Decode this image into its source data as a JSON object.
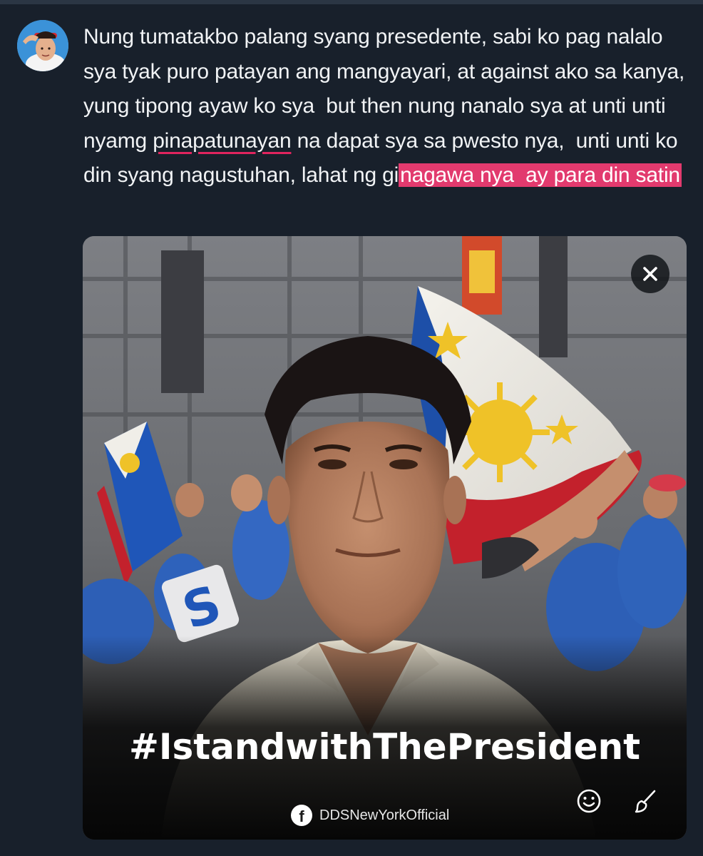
{
  "post": {
    "avatar_icon": "user-avatar",
    "text_parts": [
      {
        "text": "Nung tumatakbo palang syang presedente, sabi ko pag nalalo sya tyak puro patayan ang mangyayari, at against ako sa kanya, yung tipong ayaw ko sya  but then nung nanalo sya at unti unti nyamg ",
        "style": "plain"
      },
      {
        "text": "pinapatunayan",
        "style": "underline"
      },
      {
        "text": " na dapat sya sa pwesto nya,  unti unti ko din syang nagustuhan, lahat ng gi",
        "style": "plain"
      },
      {
        "text": "nagawa nya  ay para din satin",
        "style": "highlight"
      }
    ]
  },
  "media": {
    "hashtag": "#IstandwithThePresident",
    "source_logo_letter": "f",
    "source_name": "DDSNewYorkOfficial",
    "close_icon": "close-icon",
    "sticker_icon": "smiley-icon",
    "draw_icon": "brush-icon"
  },
  "colors": {
    "background": "#18202b",
    "text": "#f1f3f5",
    "highlight": "#e23a6e",
    "underline": "#e0245e"
  }
}
